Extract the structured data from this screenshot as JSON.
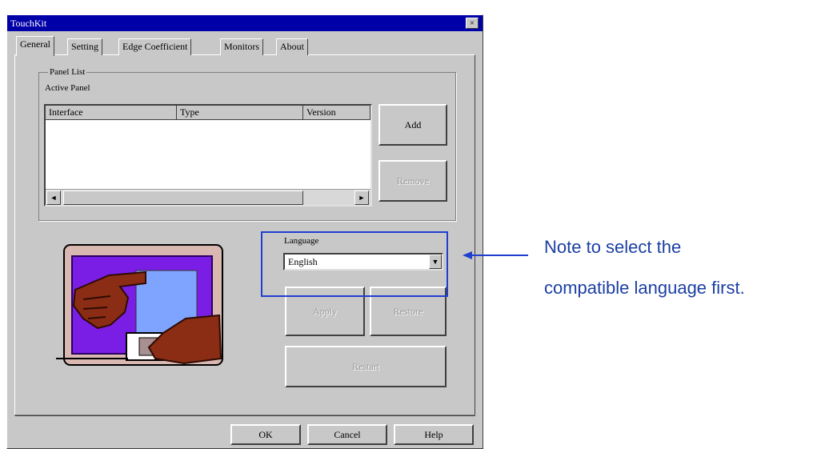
{
  "window": {
    "title": "TouchKit",
    "close_glyph": "×"
  },
  "tabs": [
    {
      "label": "General",
      "active": true
    },
    {
      "label": "Setting",
      "active": false
    },
    {
      "label": "Edge Coefficient",
      "active": false
    },
    {
      "label": "Monitors",
      "active": false
    },
    {
      "label": "About",
      "active": false
    }
  ],
  "panel_list": {
    "group_label": "Panel List",
    "active_label": "Active Panel",
    "columns": [
      "Interface",
      "Type",
      "Version"
    ],
    "rows": []
  },
  "buttons": {
    "add": "Add",
    "remove": "Remove",
    "apply": "Apply",
    "restore": "Restore",
    "disabled_wide": "Restart"
  },
  "language": {
    "label": "Language",
    "selected": "English"
  },
  "footer": {
    "ok": "OK",
    "cancel": "Cancel",
    "help": "Help"
  },
  "annotation": {
    "line1": "Note to select the",
    "line2": "compatible language first.",
    "color": "#1b3fa3",
    "box_color": "#1f3fd0"
  },
  "icons": {
    "scroll_left": "◄",
    "scroll_right": "►",
    "dropdown": "▼"
  }
}
